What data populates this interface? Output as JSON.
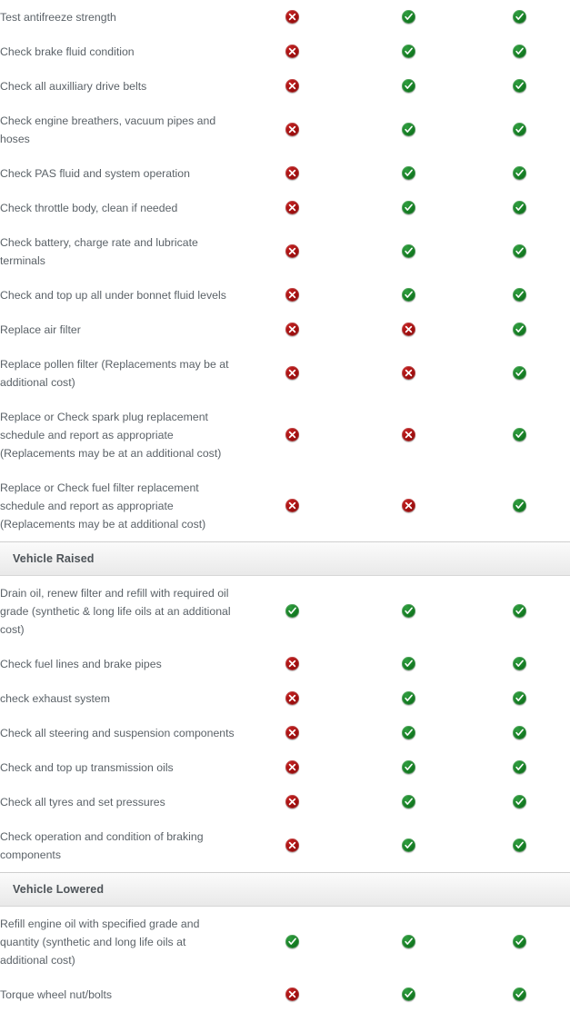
{
  "icons": {
    "yes": "check-circle-icon",
    "no": "cross-circle-icon"
  },
  "colors": {
    "yes": "#137a21",
    "no": "#9d0d0d",
    "text": "#5b6268",
    "section_header_text": "#4d5358",
    "section_header_bg": "#f3f3f3",
    "page_bg": "#ffffff"
  },
  "sections": [
    {
      "id": "under-bonnet",
      "header": null,
      "rows": [
        {
          "task": "Test antifreeze strength",
          "marks": [
            "no",
            "yes",
            "yes"
          ]
        },
        {
          "task": "Check brake fluid condition",
          "marks": [
            "no",
            "yes",
            "yes"
          ]
        },
        {
          "task": "Check all auxilliary drive belts",
          "marks": [
            "no",
            "yes",
            "yes"
          ]
        },
        {
          "task": "Check engine breathers, vacuum pipes and hoses",
          "marks": [
            "no",
            "yes",
            "yes"
          ]
        },
        {
          "task": "Check PAS fluid and system operation",
          "marks": [
            "no",
            "yes",
            "yes"
          ]
        },
        {
          "task": "Check throttle body, clean if needed",
          "marks": [
            "no",
            "yes",
            "yes"
          ]
        },
        {
          "task": "Check battery, charge rate and lubricate terminals",
          "marks": [
            "no",
            "yes",
            "yes"
          ]
        },
        {
          "task": "Check and top up all under bonnet fluid levels",
          "marks": [
            "no",
            "yes",
            "yes"
          ]
        },
        {
          "task": "Replace air filter",
          "marks": [
            "no",
            "no",
            "yes"
          ]
        },
        {
          "task": "Replace pollen filter (Replacements may be at additional cost)",
          "marks": [
            "no",
            "no",
            "yes"
          ]
        },
        {
          "task": "Replace or Check spark plug replacement schedule and report as appropriate (Replacements may be at an additional cost)",
          "marks": [
            "no",
            "no",
            "yes"
          ]
        },
        {
          "task": "Replace or Check fuel filter replacement schedule and report as appropriate (Replacements may be at additional cost)",
          "marks": [
            "no",
            "no",
            "yes"
          ]
        }
      ]
    },
    {
      "id": "vehicle-raised",
      "header": "Vehicle Raised",
      "rows": [
        {
          "task": "Drain oil, renew filter and refill with required oil grade (synthetic & long life oils at an additional cost)",
          "marks": [
            "yes",
            "yes",
            "yes"
          ]
        },
        {
          "task": "Check fuel lines and brake pipes",
          "marks": [
            "no",
            "yes",
            "yes"
          ]
        },
        {
          "task": "check exhaust system",
          "marks": [
            "no",
            "yes",
            "yes"
          ]
        },
        {
          "task": "Check all steering and suspension components",
          "marks": [
            "no",
            "yes",
            "yes"
          ]
        },
        {
          "task": "Check and top up transmission oils",
          "marks": [
            "no",
            "yes",
            "yes"
          ]
        },
        {
          "task": "Check all tyres and set pressures",
          "marks": [
            "no",
            "yes",
            "yes"
          ]
        },
        {
          "task": "Check operation and condition of braking components",
          "marks": [
            "no",
            "yes",
            "yes"
          ]
        }
      ]
    },
    {
      "id": "vehicle-lowered",
      "header": "Vehicle Lowered",
      "rows": [
        {
          "task": "Refill engine oil with specified grade and quantity (synthetic and long life oils at additional cost)",
          "marks": [
            "yes",
            "yes",
            "yes"
          ]
        },
        {
          "task": "Torque wheel nut/bolts",
          "marks": [
            "no",
            "yes",
            "yes"
          ]
        }
      ]
    }
  ]
}
